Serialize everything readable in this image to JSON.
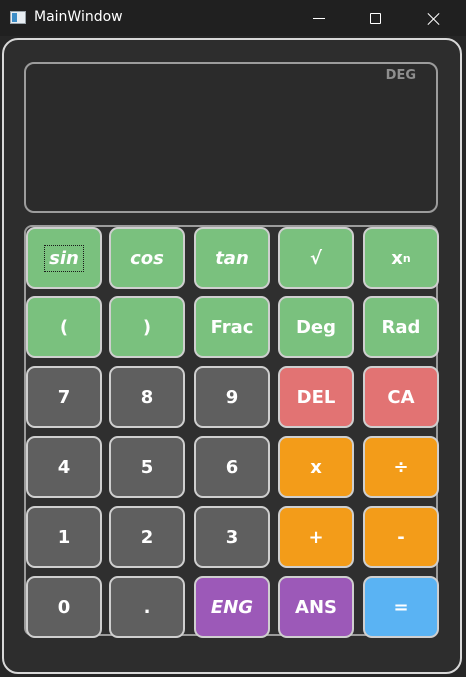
{
  "window": {
    "title": "MainWindow"
  },
  "display": {
    "mode": "DEG",
    "value": ""
  },
  "keys": {
    "sin": "sin",
    "cos": "cos",
    "tan": "tan",
    "sqrt": "√",
    "pow_base": "x",
    "pow_exp": "n",
    "lparen": "(",
    "rparen": ")",
    "frac": "Frac",
    "deg": "Deg",
    "rad": "Rad",
    "k7": "7",
    "k8": "8",
    "k9": "9",
    "del": "DEL",
    "ca": "CA",
    "k4": "4",
    "k5": "5",
    "k6": "6",
    "mul": "x",
    "div": "÷",
    "k1": "1",
    "k2": "2",
    "k3": "3",
    "add": "+",
    "sub": "-",
    "k0": "0",
    "dot": ".",
    "eng": "ENG",
    "ans": "ANS",
    "eq": "="
  },
  "colors": {
    "function_keys": "#7ac17e",
    "digit_keys": "#5f5f5f",
    "delete_keys": "#e27373",
    "operator_keys": "#f39c19",
    "mode_keys": "#9c59b8",
    "equals_key": "#5ab3f3"
  }
}
